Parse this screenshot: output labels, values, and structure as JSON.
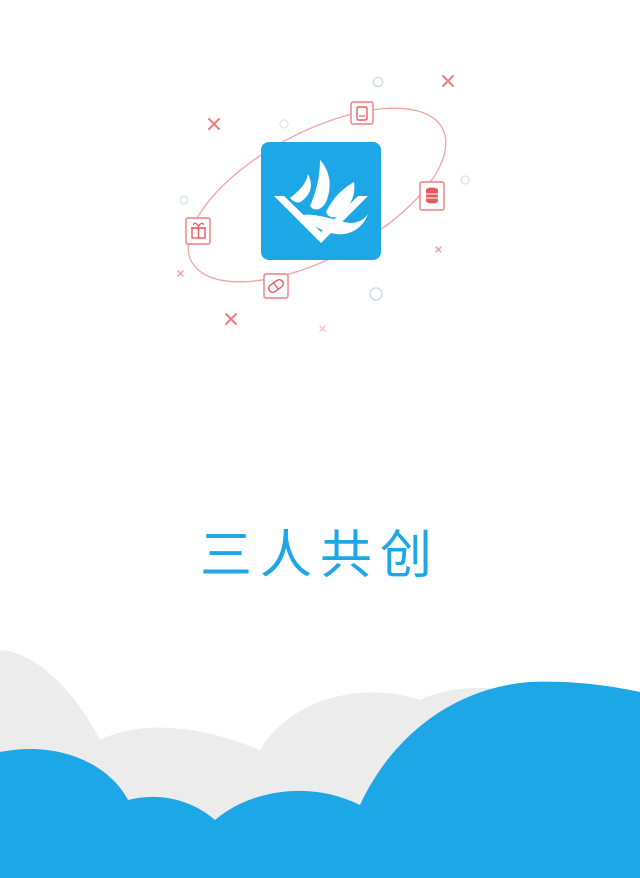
{
  "app": {
    "name": "三人共创"
  },
  "colors": {
    "brand_blue": "#1ea7e6",
    "cloud_gray": "#ececec",
    "orbit_red": "#f07c80",
    "accent_blue_dots": "#c9ddee"
  },
  "icons": {
    "logo": "app-logo-icon",
    "orbit": [
      "phone-icon",
      "coins-icon",
      "gift-icon",
      "pills-icon"
    ]
  }
}
